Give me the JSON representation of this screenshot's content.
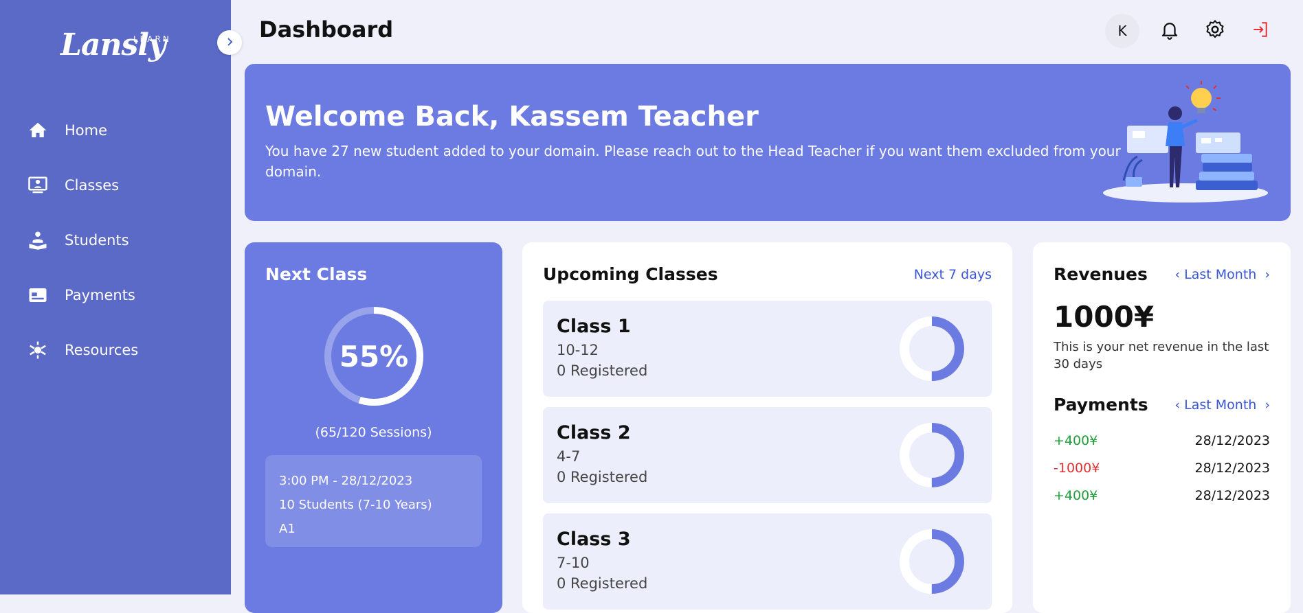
{
  "app": {
    "logo": "Lansly",
    "logo_sub": "LEARN"
  },
  "sidebar": {
    "items": [
      {
        "label": "Home",
        "icon": "home-icon"
      },
      {
        "label": "Classes",
        "icon": "classes-icon"
      },
      {
        "label": "Students",
        "icon": "students-icon"
      },
      {
        "label": "Payments",
        "icon": "payments-icon"
      },
      {
        "label": "Resources",
        "icon": "resources-icon"
      }
    ]
  },
  "header": {
    "title": "Dashboard",
    "avatar_initial": "K"
  },
  "welcome": {
    "title": "Welcome Back, Kassem Teacher",
    "message": "You have 27 new student added to your domain. Please reach out to the Head Teacher if you want them excluded from your domain."
  },
  "next_class": {
    "title": "Next Class",
    "progress": 0.55,
    "progress_label": "55%",
    "sessions": "(65/120 Sessions)",
    "time": "3:00 PM - 28/12/2023",
    "students": "10 Students (7-10 Years)",
    "level": "A1"
  },
  "upcoming": {
    "title": "Upcoming Classes",
    "range_link": "Next 7 days",
    "classes": [
      {
        "name": "Class 1",
        "range": "10-12",
        "registered": "0 Registered",
        "fill": 0.5
      },
      {
        "name": "Class 2",
        "range": "4-7",
        "registered": "0 Registered",
        "fill": 0.5
      },
      {
        "name": "Class 3",
        "range": "7-10",
        "registered": "0 Registered",
        "fill": 0.5
      }
    ]
  },
  "revenues": {
    "title": "Revenues",
    "period": "Last Month",
    "amount": "1000¥",
    "description": "This is your net revenue in the last 30 days"
  },
  "payments": {
    "title": "Payments",
    "period": "Last Month",
    "items": [
      {
        "amount": "+400¥",
        "date": "28/12/2023",
        "type": "positive"
      },
      {
        "amount": "-1000¥",
        "date": "28/12/2023",
        "type": "negative"
      },
      {
        "amount": "+400¥",
        "date": "28/12/2023",
        "type": "positive"
      }
    ]
  },
  "colors": {
    "sidebar": "#5b6ac6",
    "accent": "#6c7be2",
    "link": "#3a56d4",
    "positive": "#21a03c",
    "negative": "#e03131"
  }
}
